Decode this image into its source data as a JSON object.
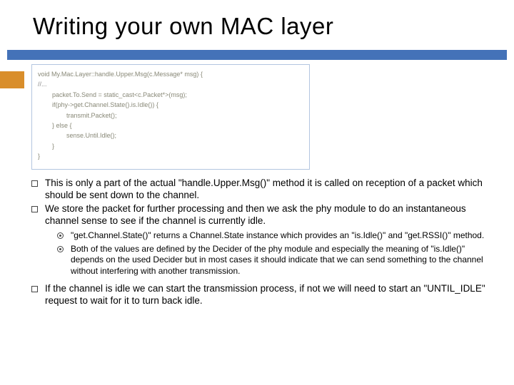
{
  "title": "Writing your own MAC layer",
  "code": {
    "l1": "void My.Mac.Layer::handle.Upper.Msg(c.Message* msg) {",
    "l2": "//...",
    "l3": "        packet.To.Send = static_cast<c.Packet*>(msg);",
    "l4": "",
    "l5": "        if(phy->get.Channel.State().is.Idle()) {",
    "l6": "                transmit.Packet();",
    "l7": "        } else {",
    "l8": "                sense.Until.Idle();",
    "l9": "        }",
    "l10": "}"
  },
  "bullets": {
    "b1": "This is only a part of the actual \"handle.Upper.Msg()\" method it is called on reception of a packet which should be sent down to the channel.",
    "b2": "We store the packet for further processing and then we ask the phy module to do an instantaneous channel sense to see if the channel is currently idle.",
    "s1": "\"get.Channel.State()\" returns a Channel.State instance which provides an \"is.Idle()\" and \"get.RSSI()\" method.",
    "s2": "Both of the values are defined by the Decider of the phy module and especially the meaning of \"is.Idle()\" depends on the used Decider but in most cases it should indicate that we can send something to the channel without interfering with another transmission.",
    "b3": "If the channel is idle we can start the transmission process, if not we will need to start an \"UNTIL_IDLE\" request to wait for it to turn back idle."
  }
}
